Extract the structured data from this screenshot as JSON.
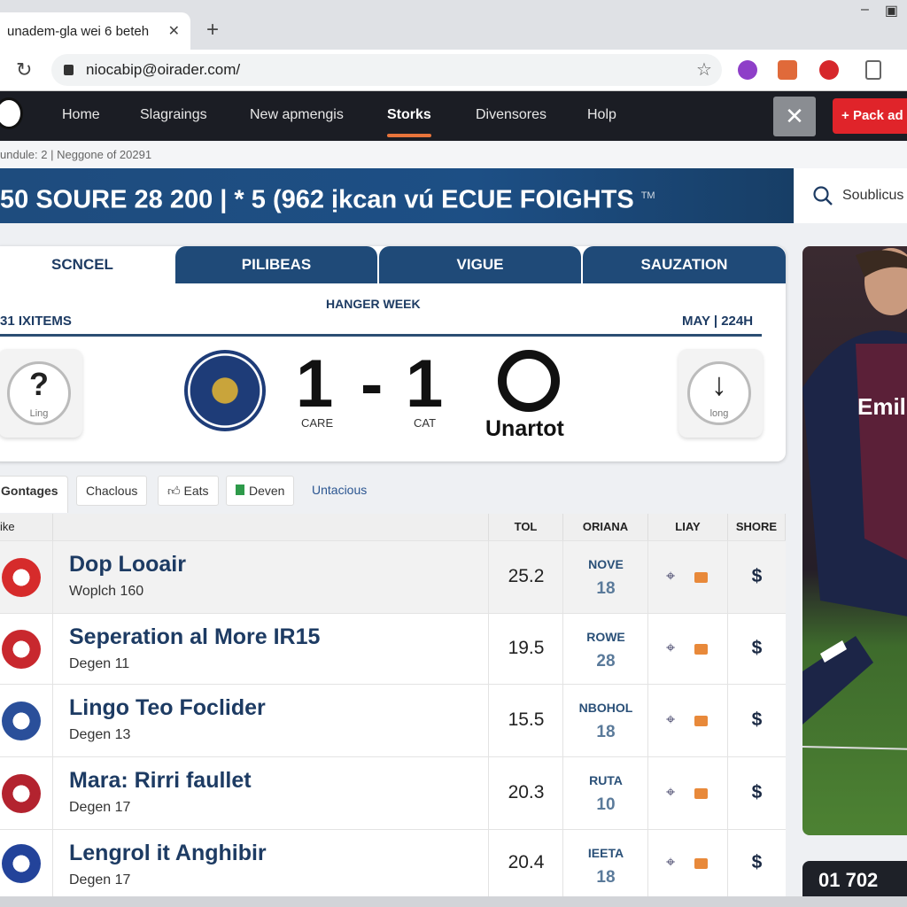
{
  "browser": {
    "tab_title": "unadem-gla wei 6 beteh",
    "url": "niocabip@oirader.com/"
  },
  "nav": {
    "items": [
      "Home",
      "Slagraings",
      "New apmengis",
      "Storks",
      "Divensores",
      "Holp"
    ],
    "active": "Storks",
    "cta": "Pack ad",
    "accent": "#e8743b"
  },
  "breadcrumb": "undule: 2  |  Neggone of 20291",
  "banner": {
    "title": "50 SOURE 28 200 | * 5 (962 ịkcan vú ECUE FOIGHTS",
    "tm": "TM",
    "search_placeholder": "Soublicus"
  },
  "card": {
    "tabs": [
      "SCNCEL",
      "PILIBEAS",
      "VIGUE",
      "SAUZATION"
    ],
    "week": "HANGER WEEK",
    "items": "31 IXITEMS",
    "date": "MAY | 224H",
    "left_btn": {
      "glyph": "?",
      "label": "Ling"
    },
    "right_btn": {
      "glyph": "↓",
      "label": "long"
    },
    "home_score": "1",
    "sep": "-",
    "away_score": "1",
    "home_label": "CARE",
    "away_label": "CAT",
    "away_team": "Unartot"
  },
  "subtabs": [
    "Gontages",
    "Chaclous",
    "Eats",
    "Deven",
    "Untacious"
  ],
  "table": {
    "headers": [
      "ike",
      "TOL",
      "ORIANA",
      "LIAY",
      "SHORE"
    ],
    "rows": [
      {
        "name": "Dop Looair",
        "sub": "Woplch 160",
        "tol": "25.2",
        "ori": "NOVE",
        "ori_n": "18",
        "shore": "$",
        "color": "#d62b2b"
      },
      {
        "name": "Seperation al More IR15",
        "sub": "Degen 11",
        "tol": "19.5",
        "ori": "ROWE",
        "ori_n": "28",
        "shore": "$",
        "color": "#c8282e"
      },
      {
        "name": "Lingo Teo Foclider",
        "sub": "Degen 13",
        "tol": "15.5",
        "ori": "NBOHOL",
        "ori_n": "18",
        "shore": "$",
        "color": "#2a4f9a"
      },
      {
        "name": "Mara: Rirri faullet",
        "sub": "Degen 17",
        "tol": "20.3",
        "ori": "RUTA",
        "ori_n": "10",
        "shore": "$",
        "color": "#b3232f"
      },
      {
        "name": "Lengrol it Anghibir",
        "sub": "Degen 17",
        "tol": "20.4",
        "ori": "IEETA",
        "ori_n": "18",
        "shore": "$",
        "color": "#23439a"
      }
    ]
  },
  "side": {
    "jersey_text": "Emil",
    "score": "01 702"
  }
}
